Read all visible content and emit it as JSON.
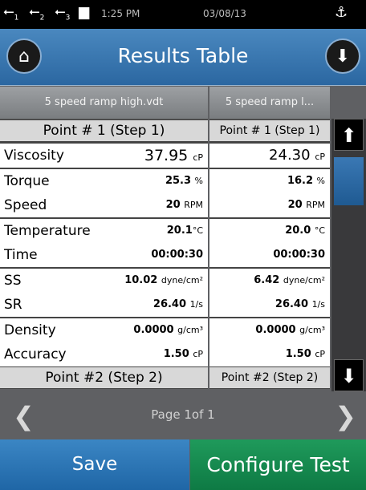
{
  "status_bar": {
    "usb_ports": [
      "1",
      "2",
      "3"
    ],
    "time": "1:25 PM",
    "date": "03/08/13"
  },
  "header": {
    "title": "Results Table"
  },
  "table": {
    "files": [
      "5 speed ramp high.vdt",
      "5 speed ramp l..."
    ],
    "columns": [
      {
        "point1": "Point # 1 (Step  1)",
        "viscosity": "37.95",
        "viscosity_unit": "cP",
        "torque": "25.3",
        "torque_unit": "%",
        "speed": "20",
        "speed_unit": "RPM",
        "temperature": "20.1",
        "temperature_unit": "°C",
        "time": "00:00:30",
        "ss": "10.02",
        "ss_unit": "dyne/cm²",
        "sr": "26.40",
        "sr_unit": "1/s",
        "density": "0.0000",
        "density_unit": "g/cm³",
        "accuracy": "1.50",
        "accuracy_unit": "cP",
        "point2": "Point #2 (Step 2)"
      },
      {
        "point1": "Point # 1 (Step  1)",
        "viscosity": "24.30",
        "viscosity_unit": "cP",
        "torque": "16.2",
        "torque_unit": "%",
        "speed": "20",
        "speed_unit": "RPM",
        "temperature": "20.0",
        "temperature_unit": "°C",
        "time": "00:00:30",
        "ss": "6.42",
        "ss_unit": "dyne/cm²",
        "sr": "26.40",
        "sr_unit": "1/s",
        "density": "0.0000",
        "density_unit": "g/cm³",
        "accuracy": "1.50",
        "accuracy_unit": "cP",
        "point2": "Point #2 (Step 2)"
      }
    ],
    "labels": {
      "viscosity": "Viscosity",
      "torque": "Torque",
      "speed": "Speed",
      "temperature": "Temperature",
      "time": "Time",
      "ss": "SS",
      "sr": "SR",
      "density": "Density",
      "accuracy": "Accuracy"
    }
  },
  "pager": {
    "text": "Page 1of 1"
  },
  "buttons": {
    "save": "Save",
    "configure": "Configure Test"
  }
}
